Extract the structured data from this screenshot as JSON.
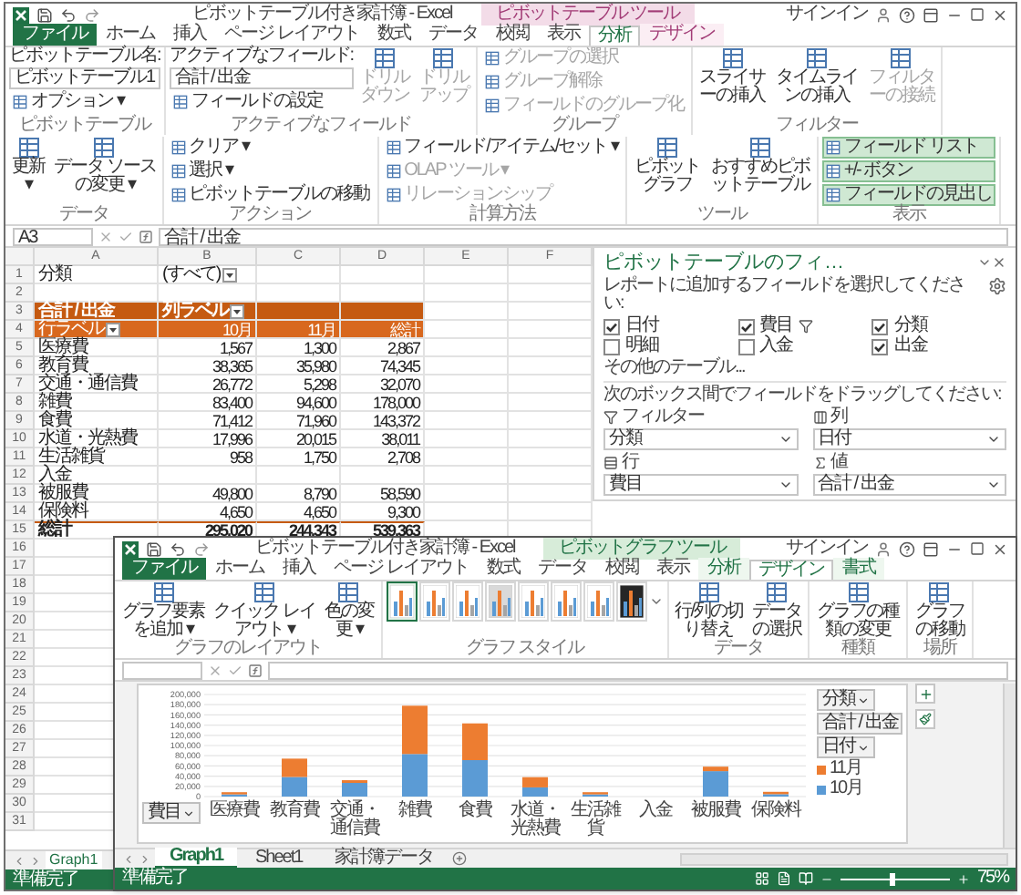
{
  "back_window": {
    "title": "ピボットテーブル付き家計簿 - Excel",
    "context_label": "ピボットテーブル ツール",
    "sign_in": "サインイン",
    "tabs": [
      {
        "label": "ファイル",
        "kind": "file",
        "selected": false
      },
      {
        "label": "ホーム",
        "kind": "normal",
        "selected": false
      },
      {
        "label": "挿入",
        "kind": "normal",
        "selected": false
      },
      {
        "label": "ページ レイアウト",
        "kind": "normal",
        "selected": false
      },
      {
        "label": "数式",
        "kind": "normal",
        "selected": false
      },
      {
        "label": "データ",
        "kind": "normal",
        "selected": false
      },
      {
        "label": "校閲",
        "kind": "normal",
        "selected": false
      },
      {
        "label": "表示",
        "kind": "normal",
        "selected": false
      },
      {
        "label": "分析",
        "kind": "contextual",
        "selected": true
      },
      {
        "label": "デザイン",
        "kind": "contextual",
        "selected": false
      }
    ],
    "ribbon_groups": [
      {
        "label": "ピボットテーブル",
        "items": [
          {
            "kind": "caption",
            "label": "ピボットテーブル名:",
            "disabled": false
          },
          {
            "kind": "field",
            "label": "ピボットテーブル1",
            "disabled": false
          },
          {
            "kind": "small",
            "label": "オプション ▾",
            "disabled": false
          }
        ]
      },
      {
        "label": "アクティブなフィールド",
        "items": [
          {
            "kind": "caption",
            "label": "アクティブなフィールド:",
            "disabled": false
          },
          {
            "kind": "field",
            "label": "合計 / 出金",
            "disabled": false
          },
          {
            "kind": "small",
            "label": "フィールドの設定",
            "disabled": false
          },
          {
            "kind": "large",
            "label": "ドリルダウン",
            "disabled": true
          },
          {
            "kind": "large",
            "label": "ドリルアップ",
            "disabled": true
          }
        ]
      },
      {
        "label": "グループ",
        "items": [
          {
            "kind": "small",
            "label": "グループの選択",
            "disabled": true
          },
          {
            "kind": "small",
            "label": "グループ解除",
            "disabled": true
          },
          {
            "kind": "small",
            "label": "フィールドのグループ化",
            "disabled": true
          }
        ]
      },
      {
        "label": "フィルター",
        "items": [
          {
            "kind": "large",
            "label": "スライサーの挿入",
            "disabled": false
          },
          {
            "kind": "large",
            "label": "タイムラインの挿入",
            "disabled": false
          },
          {
            "kind": "large",
            "label": "フィルターの接続",
            "disabled": true
          }
        ]
      },
      {
        "label": "データ",
        "items": [
          {
            "kind": "large",
            "label": "更新 ▾",
            "disabled": false
          },
          {
            "kind": "large",
            "label": "データ ソースの変更 ▾",
            "disabled": false
          }
        ]
      },
      {
        "label": "アクション",
        "items": [
          {
            "kind": "small",
            "label": "クリア ▾",
            "disabled": false
          },
          {
            "kind": "small",
            "label": "選択 ▾",
            "disabled": false
          },
          {
            "kind": "small",
            "label": "ピボットテーブルの移動",
            "disabled": false
          }
        ]
      },
      {
        "label": "計算方法",
        "items": [
          {
            "kind": "small",
            "label": "フィールド/アイテム/セット ▾",
            "disabled": false
          },
          {
            "kind": "small",
            "label": "OLAP ツール ▾",
            "disabled": true
          },
          {
            "kind": "small",
            "label": "リレーションシップ",
            "disabled": true
          }
        ]
      },
      {
        "label": "ツール",
        "items": [
          {
            "kind": "large",
            "label": "ピボットグラフ",
            "disabled": false
          },
          {
            "kind": "large",
            "label": "おすすめピボットテーブル",
            "disabled": false
          }
        ]
      },
      {
        "label": "表示",
        "items": [
          {
            "kind": "small",
            "label": "フィールド リスト",
            "disabled": false,
            "on": true
          },
          {
            "kind": "small",
            "label": "+/- ボタン",
            "disabled": false,
            "on": true
          },
          {
            "kind": "small",
            "label": "フィールドの見出し",
            "disabled": false,
            "on": true
          }
        ]
      }
    ],
    "name_box": "A3",
    "formula": "合計 / 出金",
    "columns": [
      "A",
      "B",
      "C",
      "D",
      "E",
      "F"
    ],
    "rows": [
      {
        "number": "1",
        "kind": "filter",
        "cells": [
          "分類",
          "(すべて)"
        ]
      },
      {
        "number": "2",
        "kind": "blank"
      },
      {
        "number": "3",
        "kind": "value_header",
        "cells": [
          "合計 / 出金",
          "列ラベル"
        ]
      },
      {
        "number": "4",
        "kind": "column_header",
        "cells": [
          "行ラベル",
          "10月",
          "11月",
          "総計"
        ]
      },
      {
        "number": "5",
        "kind": "item",
        "cells": [
          "医療費",
          "1,567",
          "1,300",
          "2,867"
        ]
      },
      {
        "number": "6",
        "kind": "item",
        "cells": [
          "教育費",
          "38,365",
          "35,980",
          "74,345"
        ]
      },
      {
        "number": "7",
        "kind": "item",
        "cells": [
          "交通・通信費",
          "26,772",
          "5,298",
          "32,070"
        ]
      },
      {
        "number": "8",
        "kind": "item",
        "cells": [
          "雑費",
          "83,400",
          "94,600",
          "178,000"
        ]
      },
      {
        "number": "9",
        "kind": "item",
        "cells": [
          "食費",
          "71,412",
          "71,960",
          "143,372"
        ]
      },
      {
        "number": "10",
        "kind": "item",
        "cells": [
          "水道・光熱費",
          "17,996",
          "20,015",
          "38,011"
        ]
      },
      {
        "number": "11",
        "kind": "item",
        "cells": [
          "生活雑貨",
          "958",
          "1,750",
          "2,708"
        ]
      },
      {
        "number": "12",
        "kind": "item",
        "cells": [
          "入金"
        ]
      },
      {
        "number": "13",
        "kind": "item",
        "cells": [
          "被服費",
          "49,800",
          "8,790",
          "58,590"
        ]
      },
      {
        "number": "14",
        "kind": "item",
        "cells": [
          "保険料",
          "4,650",
          "4,650",
          "9,300"
        ]
      },
      {
        "number": "15",
        "kind": "total",
        "cells": [
          "総計",
          "295,020",
          "244,343",
          "539,363"
        ]
      }
    ],
    "more_row_numbers": [
      "16",
      "17",
      "18",
      "19",
      "20",
      "21",
      "22",
      "23",
      "24",
      "25",
      "26",
      "27",
      "28",
      "29",
      "30",
      "31"
    ],
    "sheet_tab": "Graph1",
    "status": "準備完了"
  },
  "field_pane": {
    "title": "ピボットテーブルのフィ…",
    "instruction": "レポートに追加するフィールドを選択してください:",
    "fields": [
      {
        "label": "日付",
        "checked": true,
        "filtered": false
      },
      {
        "label": "費目",
        "checked": true,
        "filtered": true
      },
      {
        "label": "分類",
        "checked": true,
        "filtered": false
      },
      {
        "label": "明細",
        "checked": false,
        "filtered": false
      },
      {
        "label": "入金",
        "checked": false,
        "filtered": false
      },
      {
        "label": "出金",
        "checked": true,
        "filtered": false
      }
    ],
    "more_tables": "その他のテーブル...",
    "drag_hint": "次のボックス間でフィールドをドラッグしてください:",
    "areas": [
      {
        "kind": "filter",
        "label": "フィルター",
        "value": "分類"
      },
      {
        "kind": "columns",
        "label": "列",
        "value": "日付"
      },
      {
        "kind": "rows",
        "label": "行",
        "value": "費目"
      },
      {
        "kind": "values",
        "label": "値",
        "value": "合計 / 出金"
      }
    ]
  },
  "front_window": {
    "title": "ピボットテーブル付き家計簿 - Excel",
    "context_label": "ピボットグラフ ツール",
    "sign_in": "サインイン",
    "tabs": [
      {
        "label": "ファイル",
        "kind": "file",
        "selected": false
      },
      {
        "label": "ホーム",
        "kind": "normal",
        "selected": false
      },
      {
        "label": "挿入",
        "kind": "normal",
        "selected": false
      },
      {
        "label": "ページ レイアウト",
        "kind": "normal",
        "selected": false
      },
      {
        "label": "数式",
        "kind": "normal",
        "selected": false
      },
      {
        "label": "データ",
        "kind": "normal",
        "selected": false
      },
      {
        "label": "校閲",
        "kind": "normal",
        "selected": false
      },
      {
        "label": "表示",
        "kind": "normal",
        "selected": false
      },
      {
        "label": "分析",
        "kind": "contextual",
        "selected": false
      },
      {
        "label": "デザイン",
        "kind": "contextual",
        "selected": true
      },
      {
        "label": "書式",
        "kind": "contextual",
        "selected": false
      }
    ],
    "ribbon_groups": [
      {
        "label": "グラフのレイアウト",
        "items": [
          {
            "kind": "large",
            "label": "グラフ要素を追加 ▾",
            "disabled": false
          },
          {
            "kind": "large",
            "label": "クイック レイアウト ▾",
            "disabled": false
          },
          {
            "kind": "large",
            "label": "色の変更 ▾",
            "disabled": false
          }
        ]
      },
      {
        "label": "グラフ スタイル",
        "styles": [
          {
            "kind": "light",
            "selected": true
          },
          {
            "kind": "light",
            "selected": false
          },
          {
            "kind": "light",
            "selected": false
          },
          {
            "kind": "grey",
            "selected": false
          },
          {
            "kind": "light",
            "selected": false
          },
          {
            "kind": "light",
            "selected": false
          },
          {
            "kind": "light",
            "selected": false
          },
          {
            "kind": "dark",
            "selected": false
          }
        ]
      },
      {
        "label": "データ",
        "items": [
          {
            "kind": "large",
            "label": "行/列の切り替え",
            "disabled": false
          },
          {
            "kind": "large",
            "label": "データの選択",
            "disabled": false
          }
        ]
      },
      {
        "label": "種類",
        "items": [
          {
            "kind": "large",
            "label": "グラフの種類の変更",
            "disabled": false
          }
        ]
      },
      {
        "label": "場所",
        "items": [
          {
            "kind": "large",
            "label": "グラフの移動",
            "disabled": false
          }
        ]
      }
    ],
    "chart": {
      "field_buttons": [
        {
          "kind": "filter",
          "label": "分類"
        },
        {
          "kind": "value",
          "label": "合計 / 出金"
        },
        {
          "kind": "legend",
          "label": "日付"
        },
        {
          "kind": "axis",
          "label": "費目"
        }
      ],
      "chart_data": {
        "type": "bar",
        "stacked": true,
        "grid": true,
        "legend": "right",
        "categories": [
          "医療費",
          "教育費",
          "交通・通信費",
          "雑費",
          "食費",
          "水道・光熱費",
          "生活雑貨",
          "入金",
          "被服費",
          "保険料"
        ],
        "series": [
          {
            "name": "10月",
            "color": "#5b9bd5",
            "values": [
              1567,
              38365,
              26772,
              83400,
              71412,
              17996,
              958,
              null,
              49800,
              4650
            ]
          },
          {
            "name": "11月",
            "color": "#ed7d31",
            "values": [
              1300,
              35980,
              5298,
              94600,
              71960,
              20015,
              1750,
              null,
              8790,
              4650
            ]
          }
        ],
        "ylim": [
          0,
          200000
        ],
        "yticks": [
          {
            "value": 0,
            "label": "0"
          },
          {
            "value": 20000,
            "label": "20,000"
          },
          {
            "value": 40000,
            "label": "40,000"
          },
          {
            "value": 60000,
            "label": "60,000"
          },
          {
            "value": 80000,
            "label": "80,000"
          },
          {
            "value": 100000,
            "label": "100,000"
          },
          {
            "value": 120000,
            "label": "120,000"
          },
          {
            "value": 140000,
            "label": "140,000"
          },
          {
            "value": 160000,
            "label": "160,000"
          },
          {
            "value": 180000,
            "label": "180,000"
          },
          {
            "value": 200000,
            "label": "200,000"
          }
        ]
      }
    },
    "sheet_tabs": [
      {
        "label": "Graph1",
        "selected": true
      },
      {
        "label": "Sheet1",
        "selected": false
      },
      {
        "label": "家計簿データ",
        "selected": false
      }
    ],
    "status_bar": {
      "text": "準備完了",
      "zoom": "75%",
      "level": 0.45
    }
  }
}
